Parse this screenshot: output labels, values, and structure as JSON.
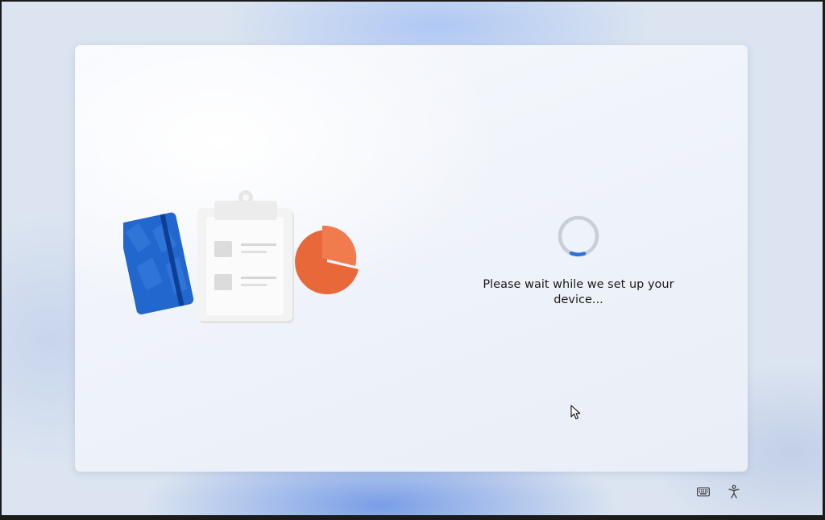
{
  "status": {
    "message": "Please wait while we set up your device...",
    "spinner_icon": "loading-spinner-icon",
    "accent_color": "#2f6fd8"
  },
  "illustration": {
    "icons": [
      "notebook-icon",
      "clipboard-icon",
      "pie-chart-icon"
    ],
    "colors": {
      "notebook": "#1f62c8",
      "clipboard": "#f1f1f1",
      "pie_chart": "#e8683a"
    }
  },
  "taskbar": {
    "icons": [
      "keyboard-icon",
      "accessibility-icon"
    ]
  }
}
